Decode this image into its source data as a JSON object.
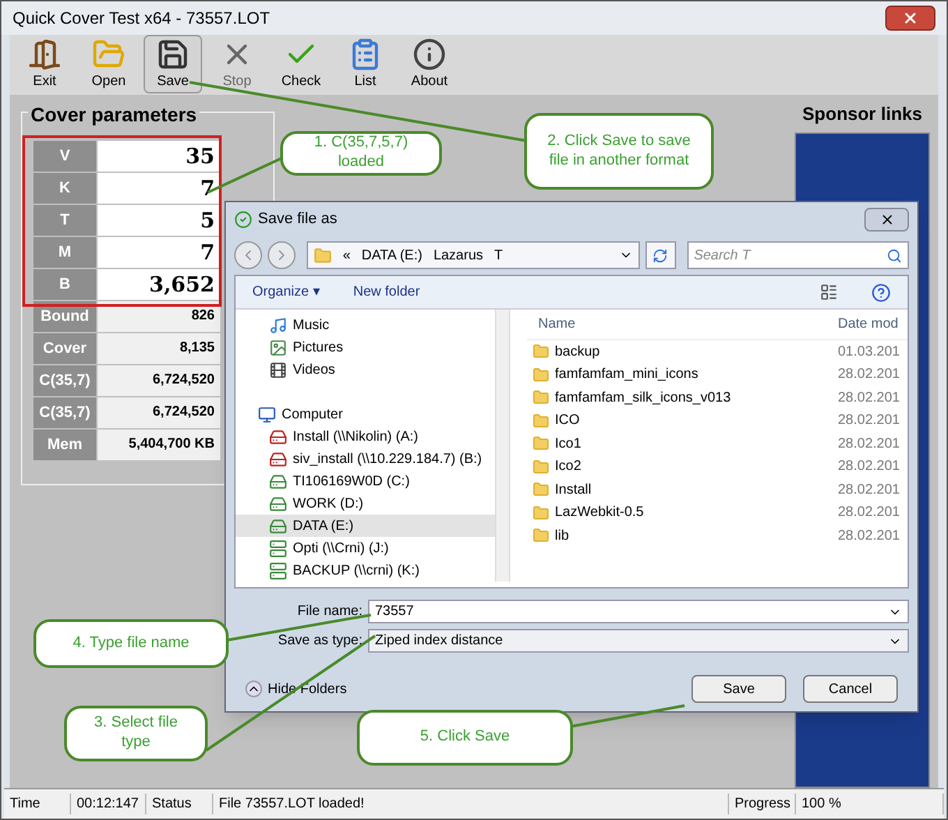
{
  "window": {
    "title": "Quick Cover Test x64 - 73557.LOT"
  },
  "toolbar": [
    {
      "label": "Exit",
      "kind": "exit",
      "selected": false,
      "disabled": false
    },
    {
      "label": "Open",
      "kind": "open",
      "selected": false,
      "disabled": false
    },
    {
      "label": "Save",
      "kind": "save",
      "selected": true,
      "disabled": false
    },
    {
      "label": "Stop",
      "kind": "stop",
      "selected": false,
      "disabled": true
    },
    {
      "label": "Check",
      "kind": "check",
      "selected": false,
      "disabled": false
    },
    {
      "label": "List",
      "kind": "list",
      "selected": false,
      "disabled": false
    },
    {
      "label": "About",
      "kind": "about",
      "selected": false,
      "disabled": false
    }
  ],
  "parameters": {
    "title": "Cover parameters",
    "rows": [
      {
        "label": "V",
        "value": "35",
        "emphasized": true
      },
      {
        "label": "K",
        "value": "7",
        "emphasized": true
      },
      {
        "label": "T",
        "value": "5",
        "emphasized": true
      },
      {
        "label": "M",
        "value": "7",
        "emphasized": true
      },
      {
        "label": "B",
        "value": "3,652",
        "emphasized": true
      },
      {
        "label": "Bound",
        "value": "826",
        "emphasized": false
      },
      {
        "label": "Cover",
        "value": "8,135",
        "emphasized": false
      },
      {
        "label": "C(35,7)",
        "value": "6,724,520",
        "emphasized": false
      },
      {
        "label": "C(35,7)",
        "value": "6,724,520",
        "emphasized": false
      },
      {
        "label": "Mem",
        "value": "5,404,700 KB",
        "emphasized": false
      }
    ]
  },
  "sponsor": {
    "title": "Sponsor links"
  },
  "dialog": {
    "title": "Save file as",
    "path": [
      "«",
      "DATA (E:)",
      "Lazarus",
      "T"
    ],
    "search": {
      "placeholder": "Search T"
    },
    "toolbar": [
      "Organize ▾",
      "New folder"
    ],
    "nav": [
      {
        "label": "Music",
        "kind": "music",
        "selected": false
      },
      {
        "label": "Pictures",
        "kind": "pictures",
        "selected": false
      },
      {
        "label": "Videos",
        "kind": "videos",
        "selected": false
      },
      {
        "label": "Computer",
        "kind": "computer",
        "selected": false
      },
      {
        "label": "Install (\\\\Nikolin) (A:)",
        "kind": "offline",
        "selected": false
      },
      {
        "label": "siv_install (\\\\10.229.184.7) (B:)",
        "kind": "offline",
        "selected": false
      },
      {
        "label": "TI106169W0D (C:)",
        "kind": "drive",
        "selected": false
      },
      {
        "label": "WORK (D:)",
        "kind": "drive",
        "selected": false
      },
      {
        "label": "DATA (E:)",
        "kind": "drive",
        "selected": true
      },
      {
        "label": "Opti (\\\\Crni) (J:)",
        "kind": "network",
        "selected": false
      },
      {
        "label": "BACKUP (\\\\crni) (K:)",
        "kind": "network",
        "selected": false
      }
    ],
    "columns": [
      "Name",
      "Date mod"
    ],
    "files": [
      {
        "name": "backup",
        "date": "01.03.201"
      },
      {
        "name": "famfamfam_mini_icons",
        "date": "28.02.201"
      },
      {
        "name": "famfamfam_silk_icons_v013",
        "date": "28.02.201"
      },
      {
        "name": "ICO",
        "date": "28.02.201"
      },
      {
        "name": "Ico1",
        "date": "28.02.201"
      },
      {
        "name": "Ico2",
        "date": "28.02.201"
      },
      {
        "name": "Install",
        "date": "28.02.201"
      },
      {
        "name": "LazWebkit-0.5",
        "date": "28.02.201"
      },
      {
        "name": "lib",
        "date": "28.02.201"
      }
    ],
    "file_name": {
      "label": "File name:",
      "value": "73557"
    },
    "save_type": {
      "label": "Save as type:",
      "value": "Ziped index distance"
    },
    "hide_folders": "Hide Folders",
    "buttons": [
      "Save",
      "Cancel"
    ]
  },
  "callouts": [
    {
      "text": "1. C(35,7,5,7) loaded"
    },
    {
      "text": "2. Click Save to save file in another format"
    },
    {
      "text": "4. Type file name"
    },
    {
      "text": "3. Select file type"
    },
    {
      "text": "5. Click Save"
    }
  ],
  "status_bar": [
    {
      "label": "Time",
      "value": "00:12:147"
    },
    {
      "label": "Status",
      "value": "File 73557.LOT loaded!"
    },
    {
      "label": "Progress",
      "value": "100 %"
    }
  ]
}
